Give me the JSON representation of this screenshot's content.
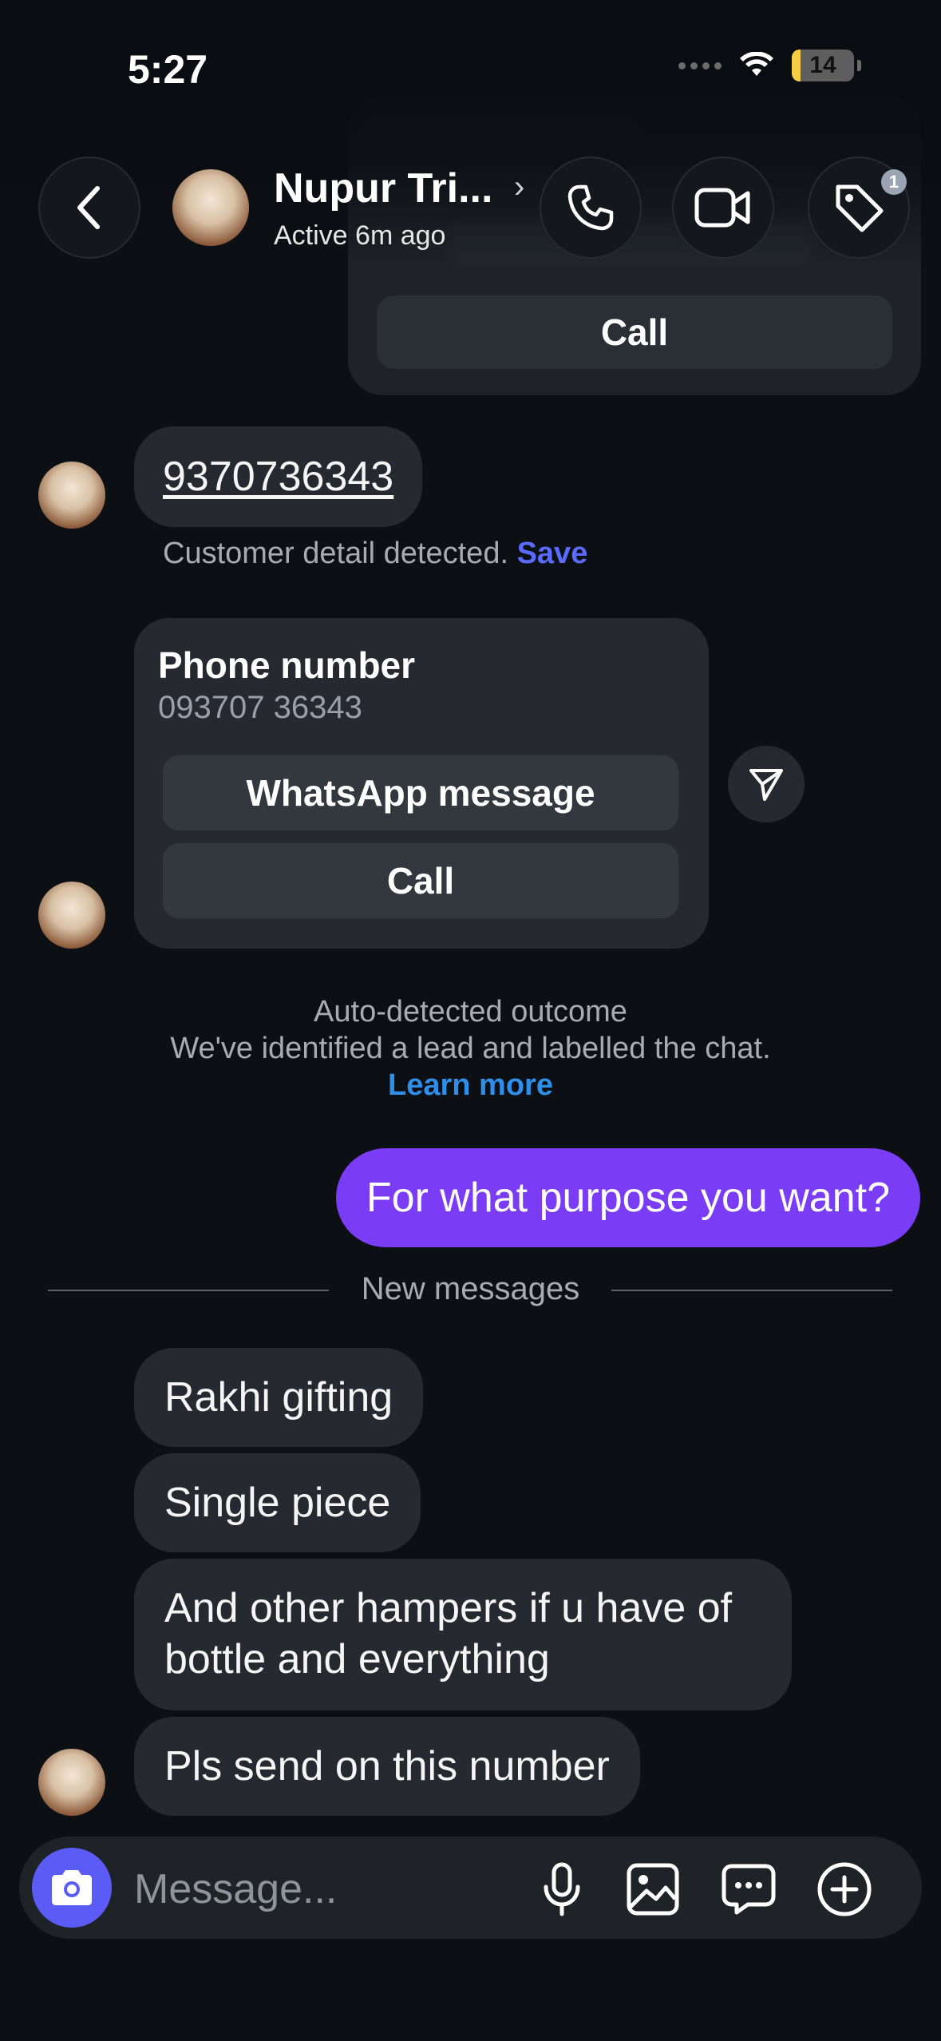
{
  "status_bar": {
    "time": "5:27",
    "battery": "14",
    "battery_level": 0.14
  },
  "previous_card": {
    "call_label": "Call"
  },
  "header": {
    "contact_name": "Nupur Tri...",
    "contact_status": "Active 6m ago",
    "tag_badge_count": "1",
    "icons": [
      "back-icon",
      "phone-icon",
      "video-icon",
      "tag-icon"
    ]
  },
  "messages": {
    "phone_message": "9370736343",
    "detected_text": "Customer detail detected.",
    "detected_save": "Save",
    "phone_card": {
      "title": "Phone number",
      "number": "093707 36343",
      "whatsapp_label": "WhatsApp message",
      "call_label": "Call"
    },
    "outcome_title": "Auto-detected outcome",
    "outcome_body": "We've identified a lead and labelled the chat.",
    "outcome_link": "Learn more",
    "outgoing": "For what purpose you want?",
    "divider_label": "New messages",
    "incoming": [
      "Rakhi gifting",
      "Single piece",
      "And other hampers if u have of bottle and everything",
      "Pls send on this number"
    ]
  },
  "composer": {
    "placeholder": "Message...",
    "icons": [
      "camera-icon",
      "mic-icon",
      "gallery-icon",
      "sticker-chat-icon",
      "plus-icon"
    ]
  },
  "colors": {
    "background": "#0c1014",
    "bubble_incoming": "#262a30",
    "bubble_outgoing": "#7b3cf6",
    "accent_save": "#5b6bff",
    "link": "#2f8fe8",
    "camera_button": "#5b5cf6"
  }
}
